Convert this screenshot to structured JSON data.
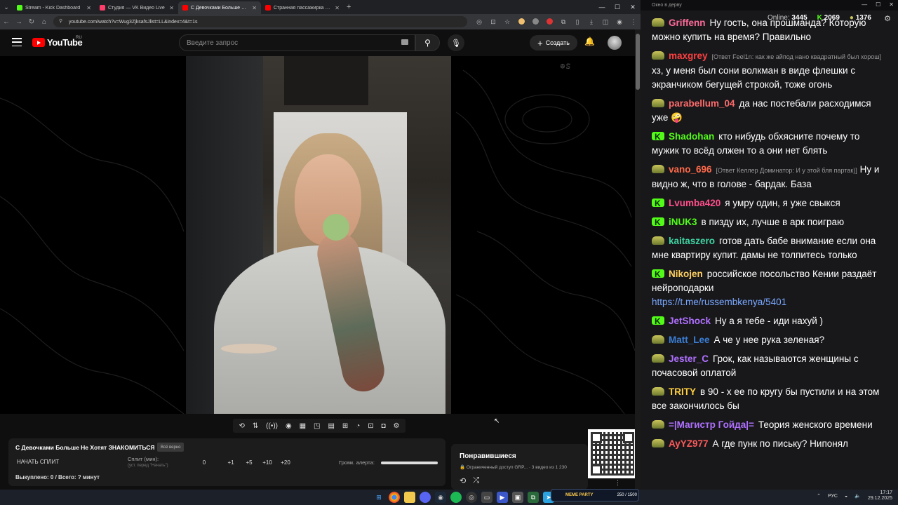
{
  "browser": {
    "tabs": [
      {
        "title": "Stream - Kick Dashboard",
        "favicon_color": "#53fc18"
      },
      {
        "title": "Студия — VK Видео Live",
        "favicon_color": "#ff3d6a"
      },
      {
        "title": "С Девочками Больше Не Хотя",
        "favicon_color": "#ff0000"
      },
      {
        "title": "Странная пассажирка 🤔 Вид",
        "favicon_color": "#ff0000"
      }
    ],
    "active_tab_index": 2,
    "url": "youtube.com/watch?v=Wug3ZjksafsJlist=LL&index=4&t=1s"
  },
  "youtube": {
    "region": "RU",
    "search_placeholder": "Введите запрос",
    "create_label": "Создать"
  },
  "split_panel": {
    "title": "С Девочками Больше Не Хотят ЗНАКОМИТЬСЯ",
    "badge": "Всё верно",
    "start_button": "НАЧАТЬ СПЛИТ",
    "split_label": "Сплит (мин):",
    "split_hint": "(уст. перед \"Начать\")",
    "split_value": "0",
    "increments": [
      "+1",
      "+5",
      "+10",
      "+20"
    ],
    "volume_label": "Громк. алерта:",
    "volume_fraction": 1.0,
    "footer": "Выкуплено: 0 / Всего: ? минут"
  },
  "liked": {
    "title": "Понравившиеся",
    "subtitle": "🔒 Ограниченный доступ GRP... · 3 видео из 1 230"
  },
  "chat": {
    "window_title": "Окно в дерву",
    "online_label": "Online:",
    "online_count": "3445",
    "kick_count": "2069",
    "other_count": "1376",
    "messages": [
      {
        "badge": "o",
        "name": "Griffenn",
        "color": "#ff6b9a",
        "reply": "",
        "text": "Ну гость, она прошманда? Которую можно купить на время? Правильно"
      },
      {
        "badge": "o",
        "name": "maxgrey",
        "color": "#ff4040",
        "reply": "[Ответ Feel1n: как же айпод нано квадратный был хорош]",
        "text": "хз, у меня был сони волкман в виде флешки с экранчиком бегущей строкой, тоже огонь"
      },
      {
        "badge": "o",
        "name": "parabellum_04",
        "color": "#ff6b6b",
        "reply": "",
        "text": "да нас постебали расходимся уже 🤪"
      },
      {
        "badge": "k",
        "name": "Shadohan",
        "color": "#53fc18",
        "reply": "",
        "text": "кто нибудь обхясните почему то мужик то всёд олжен то а они нет блять"
      },
      {
        "badge": "o",
        "name": "vano_696",
        "color": "#ff6a4a",
        "reply": "[Ответ Келлер Доминатор: И у этой бля партак)]",
        "text": "Ну и видно ж, что в голове - бардак. База"
      },
      {
        "badge": "k",
        "name": "Lvumba420",
        "color": "#ff4f8a",
        "reply": "",
        "text": "я умру один, я уже свыкся"
      },
      {
        "badge": "k",
        "name": "iNUK3",
        "color": "#53fc18",
        "reply": "",
        "text": "в пизду их, лучше в арк поиграю"
      },
      {
        "badge": "o",
        "name": "kaitaszero",
        "color": "#3fd3a0",
        "reply": "",
        "text": "готов дать бабе внимание если она мне квартиру купит. дамы не толпитесь только"
      },
      {
        "badge": "k",
        "name": "Nikojen",
        "color": "#ffd060",
        "reply": "",
        "text": "российское посольство Кении раздаёт нейроподарки",
        "link": "https://t.me/russembkenya/5401"
      },
      {
        "badge": "k",
        "name": "JetShock",
        "color": "#b070ff",
        "reply": "",
        "text": "Ну а я тебе - иди нахуй )"
      },
      {
        "badge": "o",
        "name": "Matt_Lee",
        "color": "#3a7fd6",
        "reply": "",
        "text": "А че у нее рука зеленая?"
      },
      {
        "badge": "o",
        "name": "Jester_C",
        "color": "#b070ff",
        "reply": "",
        "text": "Грок, как называются женщины с почасовой оплатой"
      },
      {
        "badge": "o",
        "name": "TRITY",
        "color": "#ffd040",
        "reply": "",
        "text": "в 90 - х ее по кругу бы пустили и на этом все закончилось бы"
      },
      {
        "badge": "o",
        "name": "=|Магистр Гойда|=",
        "color": "#b070ff",
        "reply": "",
        "text": "Теория женского времени"
      },
      {
        "badge": "o",
        "name": "AyYZ977",
        "color": "#ff5a5a",
        "reply": "",
        "text": "А где пунк по письку? Нипонял"
      }
    ]
  },
  "taskbar": {
    "game_label": "MEME PARTY",
    "game_progress": "250 / 1500",
    "lang": "РУС",
    "time": "17:17",
    "date": "29.12.2025"
  }
}
